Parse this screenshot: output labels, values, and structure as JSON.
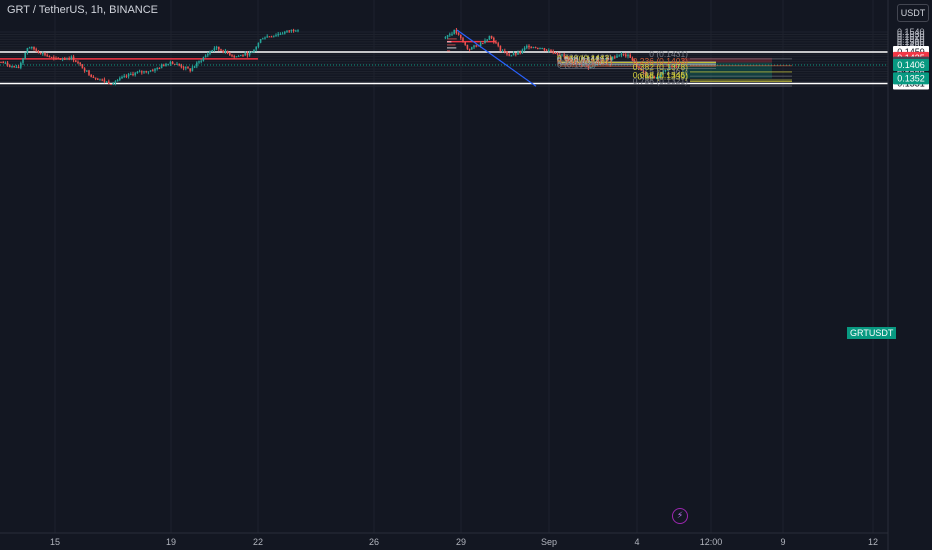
{
  "header": {
    "symbol": "GRT / TetherUS, 1h, BINANCE",
    "currency": "USDT",
    "ticker": "GRTUSDT"
  },
  "colors": {
    "background": "#131722",
    "up": "#26a69a",
    "down": "#ef5350",
    "text": "#b2b5be",
    "white_level": "#ffffff",
    "red_level": "#f23645",
    "blue_line": "#2962ff",
    "fib_yellow": "#d4cf3c",
    "fib_gray": "#787b86",
    "short_stop_zone": "#f23645",
    "short_target_zone": "#089981"
  },
  "chart_data": {
    "type": "candlestick",
    "ylim": [
      0.1318,
      0.1552
    ],
    "y_ticks": [
      "0.1540",
      "0.1530",
      "0.1520",
      "0.1510",
      "0.1500",
      "0.1490",
      "0.1480",
      "0.1470",
      "0.1460",
      "0.1450",
      "0.1440",
      "0.1430",
      "0.1420",
      "0.1410",
      "0.1400",
      "0.1390",
      "0.1380",
      "0.1370",
      "0.1360",
      "0.1350",
      "0.1340",
      "0.1330",
      "0.1320"
    ],
    "x_ticks": [
      "15",
      "19",
      "22",
      "26",
      "29",
      "Sep",
      "4",
      "12:00",
      "9",
      "12"
    ],
    "series_anchors": [
      {
        "x": 0,
        "y": 0.142
      },
      {
        "x": 18,
        "y": 0.139
      },
      {
        "x": 28,
        "y": 0.1482
      },
      {
        "x": 55,
        "y": 0.1428
      },
      {
        "x": 72,
        "y": 0.1436
      },
      {
        "x": 92,
        "y": 0.136
      },
      {
        "x": 110,
        "y": 0.1332
      },
      {
        "x": 132,
        "y": 0.137
      },
      {
        "x": 155,
        "y": 0.1388
      },
      {
        "x": 170,
        "y": 0.142
      },
      {
        "x": 190,
        "y": 0.1385
      },
      {
        "x": 205,
        "y": 0.1442
      },
      {
        "x": 215,
        "y": 0.1478
      },
      {
        "x": 235,
        "y": 0.144
      },
      {
        "x": 252,
        "y": 0.1455
      },
      {
        "x": 262,
        "y": 0.1518
      },
      {
        "x": 275,
        "y": 0.1528
      },
      {
        "x": 290,
        "y": 0.1545
      },
      {
        "x": 300,
        "y": 0.1555
      },
      {
        "x": 445,
        "y": 0.152
      },
      {
        "x": 455,
        "y": 0.1545
      },
      {
        "x": 468,
        "y": 0.147
      },
      {
        "x": 480,
        "y": 0.149
      },
      {
        "x": 490,
        "y": 0.1525
      },
      {
        "x": 500,
        "y": 0.147
      },
      {
        "x": 510,
        "y": 0.1445
      },
      {
        "x": 520,
        "y": 0.1455
      },
      {
        "x": 528,
        "y": 0.1485
      },
      {
        "x": 545,
        "y": 0.147
      },
      {
        "x": 560,
        "y": 0.145
      },
      {
        "x": 570,
        "y": 0.1423
      },
      {
        "x": 580,
        "y": 0.1412
      },
      {
        "x": 590,
        "y": 0.1395
      },
      {
        "x": 600,
        "y": 0.142
      },
      {
        "x": 608,
        "y": 0.1428
      },
      {
        "x": 620,
        "y": 0.145
      },
      {
        "x": 630,
        "y": 0.144
      },
      {
        "x": 638,
        "y": 0.1395
      },
      {
        "x": 645,
        "y": 0.1365
      },
      {
        "x": 652,
        "y": 0.1352
      },
      {
        "x": 660,
        "y": 0.136
      },
      {
        "x": 665,
        "y": 0.139
      },
      {
        "x": 672,
        "y": 0.14
      },
      {
        "x": 680,
        "y": 0.1406
      }
    ],
    "horizontal_levels": [
      {
        "value": 0.1459,
        "color": "#ffffff",
        "label": "0.1459"
      },
      {
        "value": 0.1331,
        "color": "#ffffff",
        "label": "0.1331"
      },
      {
        "value": 0.1431,
        "color": "#f23645",
        "label": null
      },
      {
        "value": 0.1501,
        "color": "#f23645",
        "label": null
      }
    ],
    "price_labels": [
      {
        "value": 0.1435,
        "text": "0.1435",
        "bg": "#f23645"
      },
      {
        "value": 0.1416,
        "text": "0.1416",
        "bg": "#434651"
      },
      {
        "value": 0.1406,
        "text": "0.1406",
        "bg": "#089981"
      },
      {
        "value": 0.1352,
        "text": "0.1352",
        "bg": "#089981"
      }
    ],
    "fib_upper": [
      {
        "text": "0.786 (0.1421)",
        "value": 0.1421,
        "color": "#787b86"
      },
      {
        "text": "0.618 (0.1417)",
        "value": 0.1417,
        "color": "#d4cf3c"
      },
      {
        "text": "0.66 (0.1416)",
        "value": 0.1416,
        "color": "#d4cf3c"
      },
      {
        "text": "0.5 (0.1411)",
        "value": 0.1411,
        "color": "#b2b5be"
      },
      {
        "text": "0.382 (0.1407)",
        "value": 0.1407,
        "color": "#b2b5be"
      },
      {
        "text": "0.236 (0.1401)",
        "value": 0.1401,
        "color": "#d35f39"
      },
      {
        "text": "0 (0.1392)",
        "value": 0.1392,
        "color": "#787b86"
      }
    ],
    "fib_lower": [
      {
        "text": "0 (0.1431)",
        "value": 0.1431,
        "color": "#787b86"
      },
      {
        "text": "0.236 (0.1403)",
        "value": 0.1403,
        "color": "#d35f39"
      },
      {
        "text": "0.382 (0.1378)",
        "value": 0.1378,
        "color": "#d4cf3c"
      },
      {
        "text": "0.5 (0.1361)",
        "value": 0.1361,
        "color": "#787b86"
      },
      {
        "text": "0.618 (0.1345)",
        "value": 0.1345,
        "color": "#d4cf3c"
      },
      {
        "text": "0.66 (0.1339)",
        "value": 0.1339,
        "color": "#d4cf3c"
      },
      {
        "text": "0.786 (0.1321)",
        "value": 0.1321,
        "color": "#787b86"
      }
    ],
    "short_position": {
      "entry": 0.1416,
      "stop": 0.1435,
      "target": 0.1352
    },
    "trend_line": {
      "from": {
        "x": 457,
        "value": 0.1548
      },
      "to": {
        "x": 536,
        "value": 0.132
      }
    },
    "volume_profile": {
      "x": 447,
      "top": 0.1512,
      "bottom": 0.146
    }
  }
}
